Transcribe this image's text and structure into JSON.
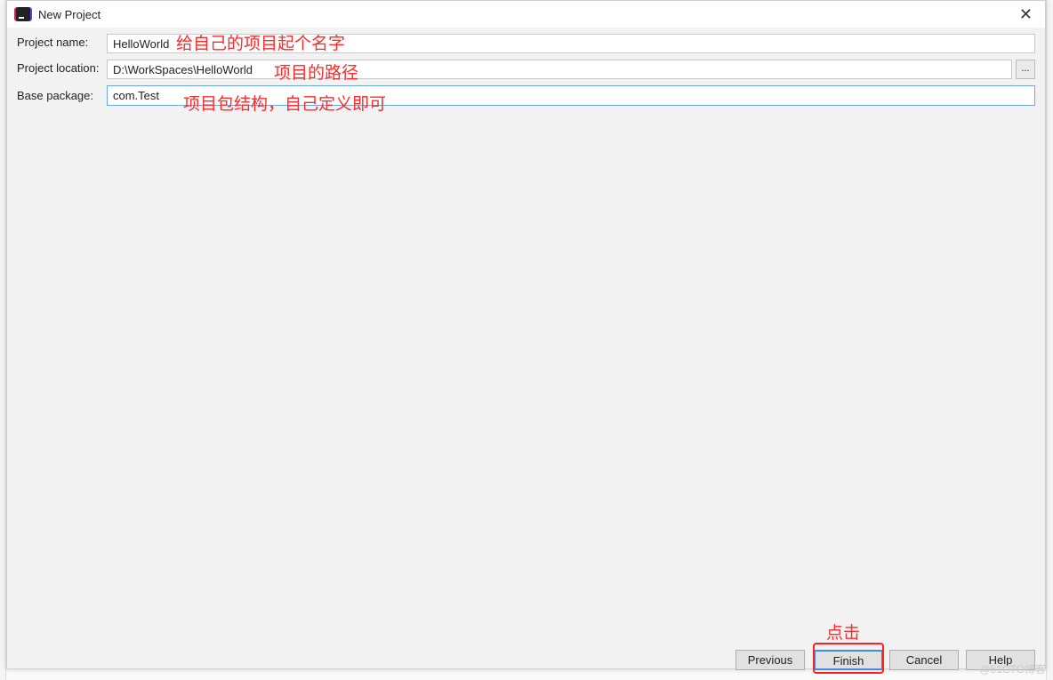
{
  "window": {
    "title": "New Project",
    "close_icon": "close-icon"
  },
  "form": {
    "project_name": {
      "label": "Project name:",
      "value": "HelloWorld"
    },
    "project_location": {
      "label": "Project location:",
      "value": "D:\\WorkSpaces\\HelloWorld",
      "browse_label": "..."
    },
    "base_package": {
      "label": "Base package:",
      "value": "com.Test"
    }
  },
  "annotations": {
    "name": "给自己的项目起个名字",
    "location": "项目的路径",
    "package": "项目包结构，自己定义即可",
    "click": "点击"
  },
  "buttons": {
    "previous": "Previous",
    "finish": "Finish",
    "cancel": "Cancel",
    "help": "Help"
  },
  "watermark": "@51CTO博客",
  "colors": {
    "annotation": "#ff2a2a",
    "focus": "#3c8ce0"
  }
}
